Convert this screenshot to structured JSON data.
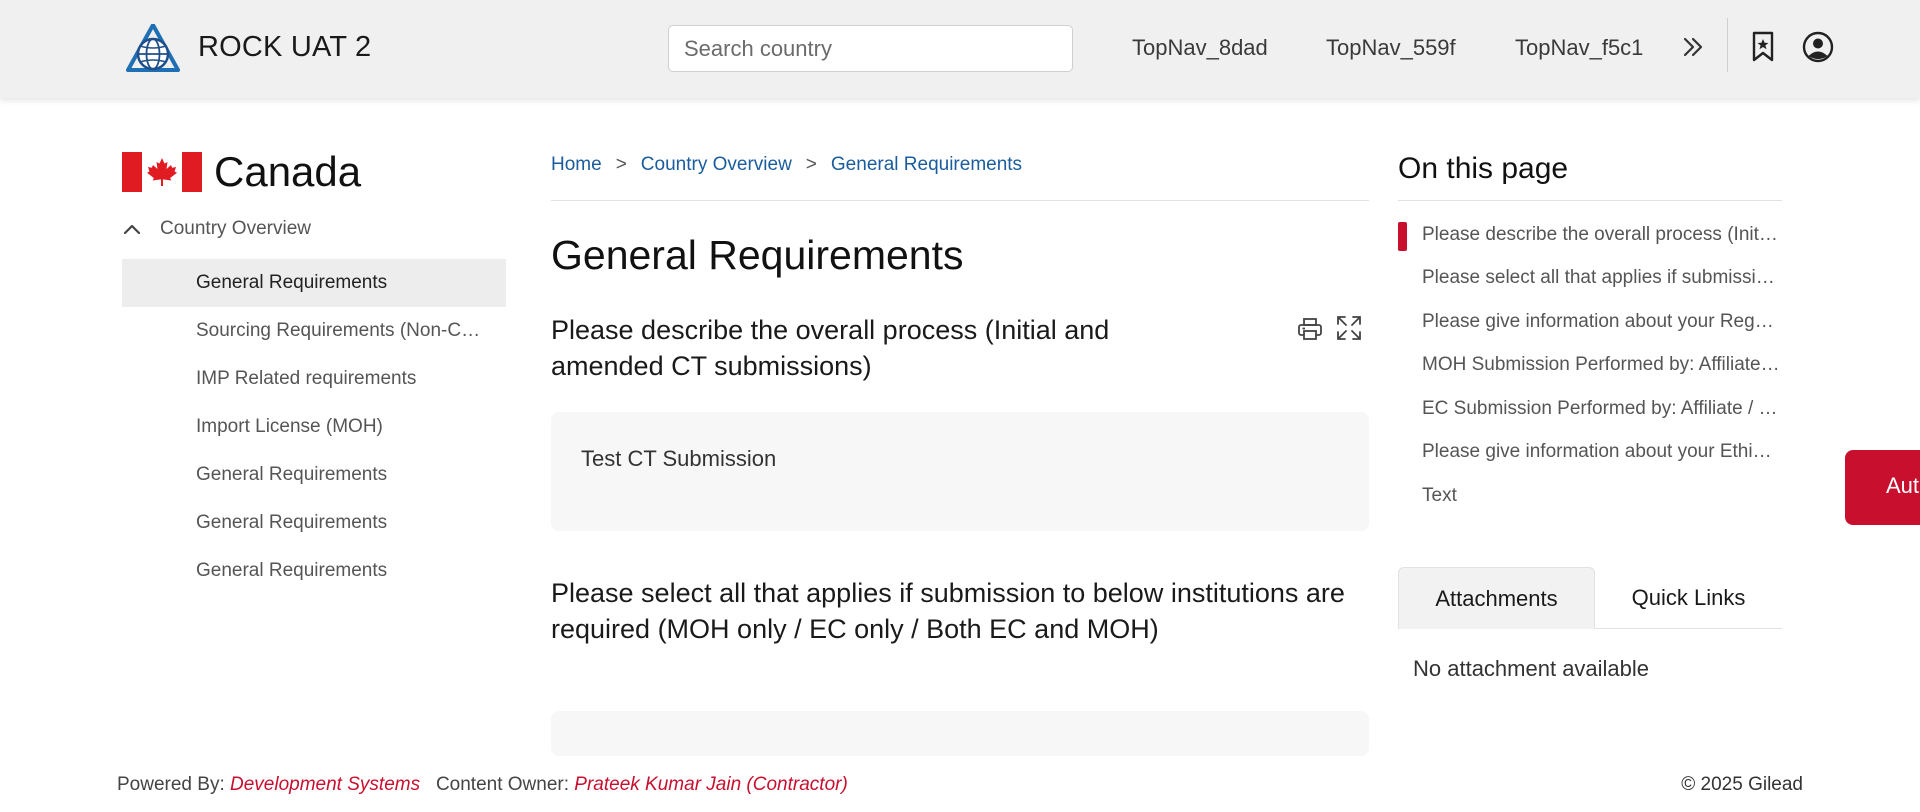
{
  "header": {
    "app_title": "ROCK UAT 2",
    "search_placeholder": "Search country",
    "topnav": [
      "TopNav_8dad",
      "TopNav_559f",
      "TopNav_f5c1"
    ],
    "more_icon": "double-chevron-right-icon",
    "bookmark_icon": "bookmark-star-icon",
    "user_icon": "user-circle-icon"
  },
  "sidebar": {
    "country": "Canada",
    "group_label": "Country Overview",
    "items": [
      {
        "label": "General Requirements",
        "active": true
      },
      {
        "label": "Sourcing Requirements (Non-Commercial)"
      },
      {
        "label": "IMP Related requirements"
      },
      {
        "label": "Import License (MOH)"
      },
      {
        "label": "General Requirements"
      },
      {
        "label": "General Requirements"
      },
      {
        "label": "General Requirements"
      }
    ]
  },
  "main": {
    "breadcrumb": [
      "Home",
      "Country Overview",
      "General Requirements"
    ],
    "breadcrumb_separator": ">",
    "title": "General Requirements",
    "questions": [
      {
        "text": "Please describe the overall process (Initial and amended CT submissions)",
        "answer": "Test CT Submission"
      },
      {
        "text": "Please select all that applies if submission to below institutions are required (MOH only / EC only / Both EC and MOH)",
        "answer": ""
      }
    ]
  },
  "on_this_page": {
    "title": "On this page",
    "items": [
      "Please describe the overall process (Initial and amended CT submissions)",
      "Please select all that applies if submission to below institutions are required",
      "Please give information about your Regulatory submission",
      "MOH Submission Performed by: Affiliate / CRO",
      "EC Submission Performed by: Affiliate / CRO",
      "Please give information about your Ethics Committee",
      "Text"
    ]
  },
  "tabs": {
    "attachments": "Attachments",
    "quick_links": "Quick Links",
    "empty_message": "No attachment available"
  },
  "side_tab": "Aut",
  "footer": {
    "powered_by_label": "Powered By:",
    "powered_by": "Development Systems",
    "owner_label": "Content Owner:",
    "owner": "Prateek Kumar Jain (Contractor)",
    "copyright": "© 2025 Gilead"
  },
  "colors": {
    "accent": "#c8102e",
    "link": "#1a5c9e",
    "header_bg": "#f0f0f0"
  }
}
